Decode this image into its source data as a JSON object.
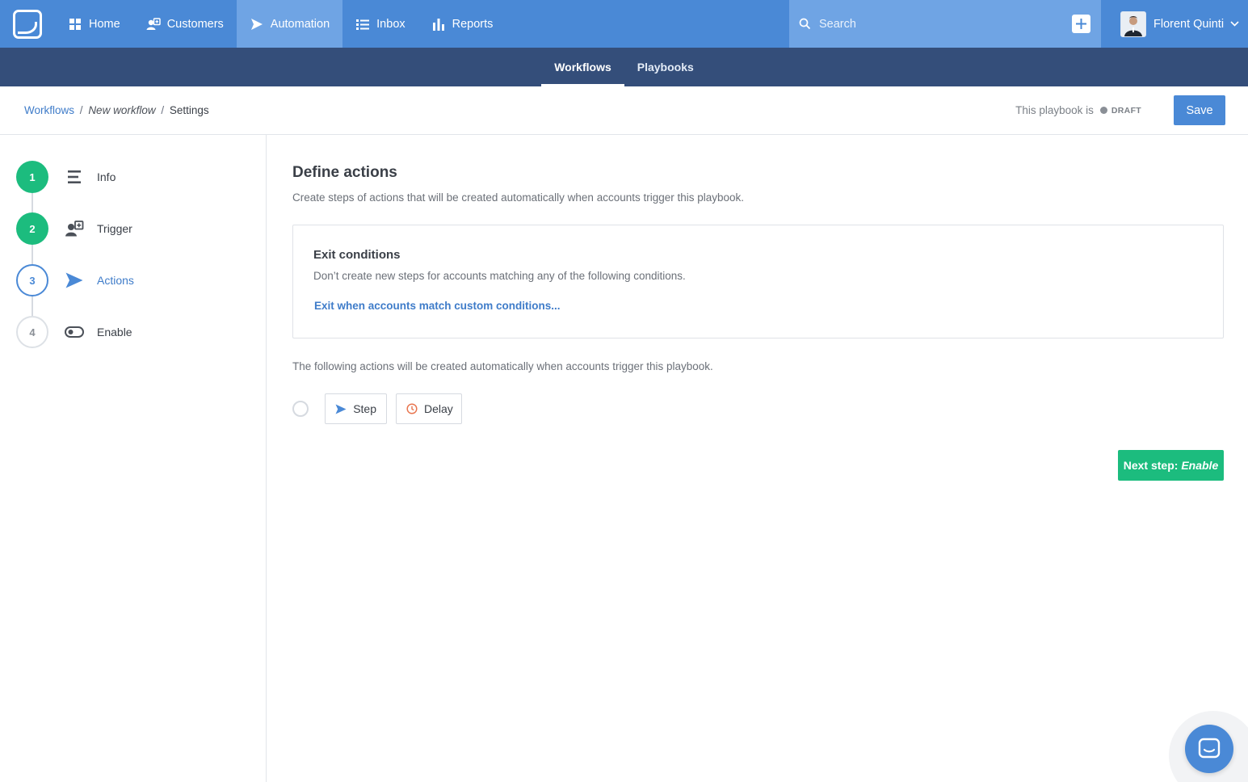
{
  "topnav": {
    "items": [
      {
        "label": "Home",
        "icon": "grid-icon"
      },
      {
        "label": "Customers",
        "icon": "customers-icon"
      },
      {
        "label": "Automation",
        "icon": "paper-plane-icon",
        "active": true
      },
      {
        "label": "Inbox",
        "icon": "list-icon"
      },
      {
        "label": "Reports",
        "icon": "bar-chart-icon"
      }
    ],
    "search_placeholder": "Search",
    "user_name": "Florent Quinti"
  },
  "subnav": {
    "tabs": [
      {
        "label": "Workflows",
        "active": true
      },
      {
        "label": "Playbooks",
        "active": false
      }
    ]
  },
  "header": {
    "breadcrumb": {
      "root": "Workflows",
      "sep": "/",
      "middle": "New workflow",
      "current": "Settings"
    },
    "status_text": "This playbook is",
    "status_badge": "DRAFT",
    "save_label": "Save"
  },
  "steps": [
    {
      "number": "1",
      "label": "Info",
      "state": "done",
      "icon": "menu-lines-icon"
    },
    {
      "number": "2",
      "label": "Trigger",
      "state": "done",
      "icon": "trigger-icon"
    },
    {
      "number": "3",
      "label": "Actions",
      "state": "current",
      "icon": "paper-plane-icon"
    },
    {
      "number": "4",
      "label": "Enable",
      "state": "todo",
      "icon": "toggle-icon"
    }
  ],
  "main": {
    "title": "Define actions",
    "subtitle": "Create steps of actions that will be created automatically when accounts trigger this playbook.",
    "exit": {
      "title": "Exit conditions",
      "description": "Don’t create new steps for accounts matching any of the following conditions.",
      "link": "Exit when accounts match custom conditions..."
    },
    "following_text": "The following actions will be created automatically when accounts trigger this playbook.",
    "step_button": "Step",
    "delay_button": "Delay",
    "next_prefix": "Next step:",
    "next_target": "Enable"
  },
  "colors": {
    "primary": "#4a89d6",
    "subnav": "#344e7a",
    "success": "#1cbc7e",
    "delay": "#e8754f"
  }
}
